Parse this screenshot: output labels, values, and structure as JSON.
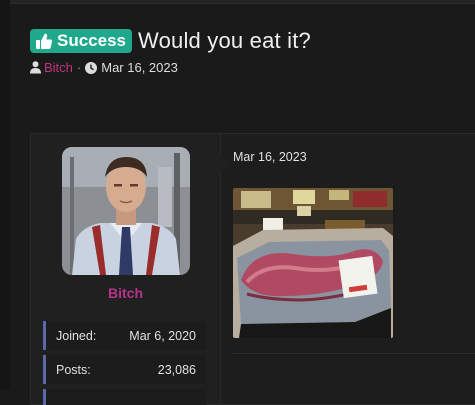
{
  "thread": {
    "prefix_label": "Success",
    "title": "Would you eat it?",
    "author": "Bitch",
    "separator": "·",
    "date": "Mar 16, 2023"
  },
  "post": {
    "date": "Mar 16, 2023",
    "username": "Bitch",
    "stats": [
      {
        "label": "Joined:",
        "value": "Mar 6, 2020"
      },
      {
        "label": "Posts:",
        "value": "23,086"
      }
    ]
  },
  "colors": {
    "prefix_badge": "#1fa88c",
    "username": "#b7328a",
    "stat_accent": "#5868a8"
  },
  "icons": {
    "prefix": "thumbs-up-icon",
    "author": "user-icon",
    "date": "clock-icon"
  }
}
